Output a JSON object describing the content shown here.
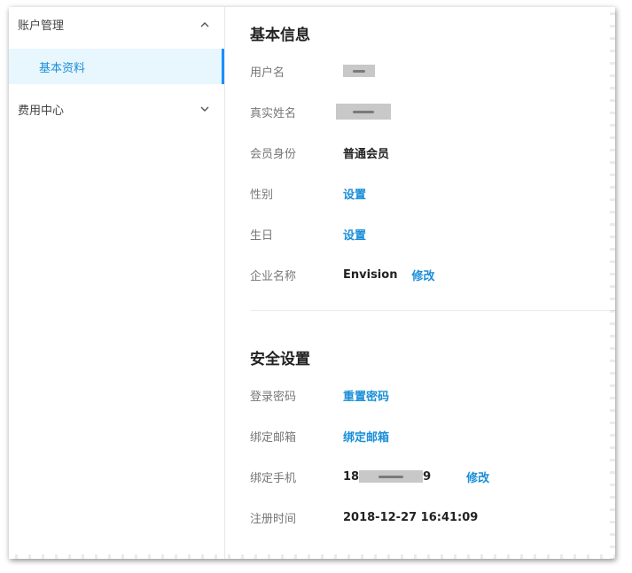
{
  "sidebar": {
    "account_group": {
      "label": "账户管理",
      "icon": "chevron-up-icon"
    },
    "account_items": [
      {
        "label": "基本资料",
        "active": true
      }
    ],
    "billing_group": {
      "label": "费用中心",
      "icon": "chevron-down-icon"
    }
  },
  "basic_info": {
    "title": "基本信息",
    "username": {
      "label": "用户名"
    },
    "real_name": {
      "label": "真实姓名"
    },
    "member": {
      "label": "会员身份",
      "value": "普通会员"
    },
    "gender": {
      "label": "性别",
      "action": "设置"
    },
    "birthday": {
      "label": "生日",
      "action": "设置"
    },
    "company": {
      "label": "企业名称",
      "value": "Envision",
      "action": "修改"
    }
  },
  "security": {
    "title": "安全设置",
    "password": {
      "label": "登录密码",
      "action": "重置密码"
    },
    "email": {
      "label": "绑定邮箱",
      "action": "绑定邮箱"
    },
    "phone": {
      "label": "绑定手机",
      "value_prefix": "18",
      "value_suffix": "9",
      "action": "修改"
    },
    "register_time": {
      "label": "注册时间",
      "value": "2018-12-27 16:41:09"
    }
  },
  "colors": {
    "accent": "#1a8fd8",
    "active_bg": "#e8f6fe",
    "active_bar": "#1890ff"
  }
}
